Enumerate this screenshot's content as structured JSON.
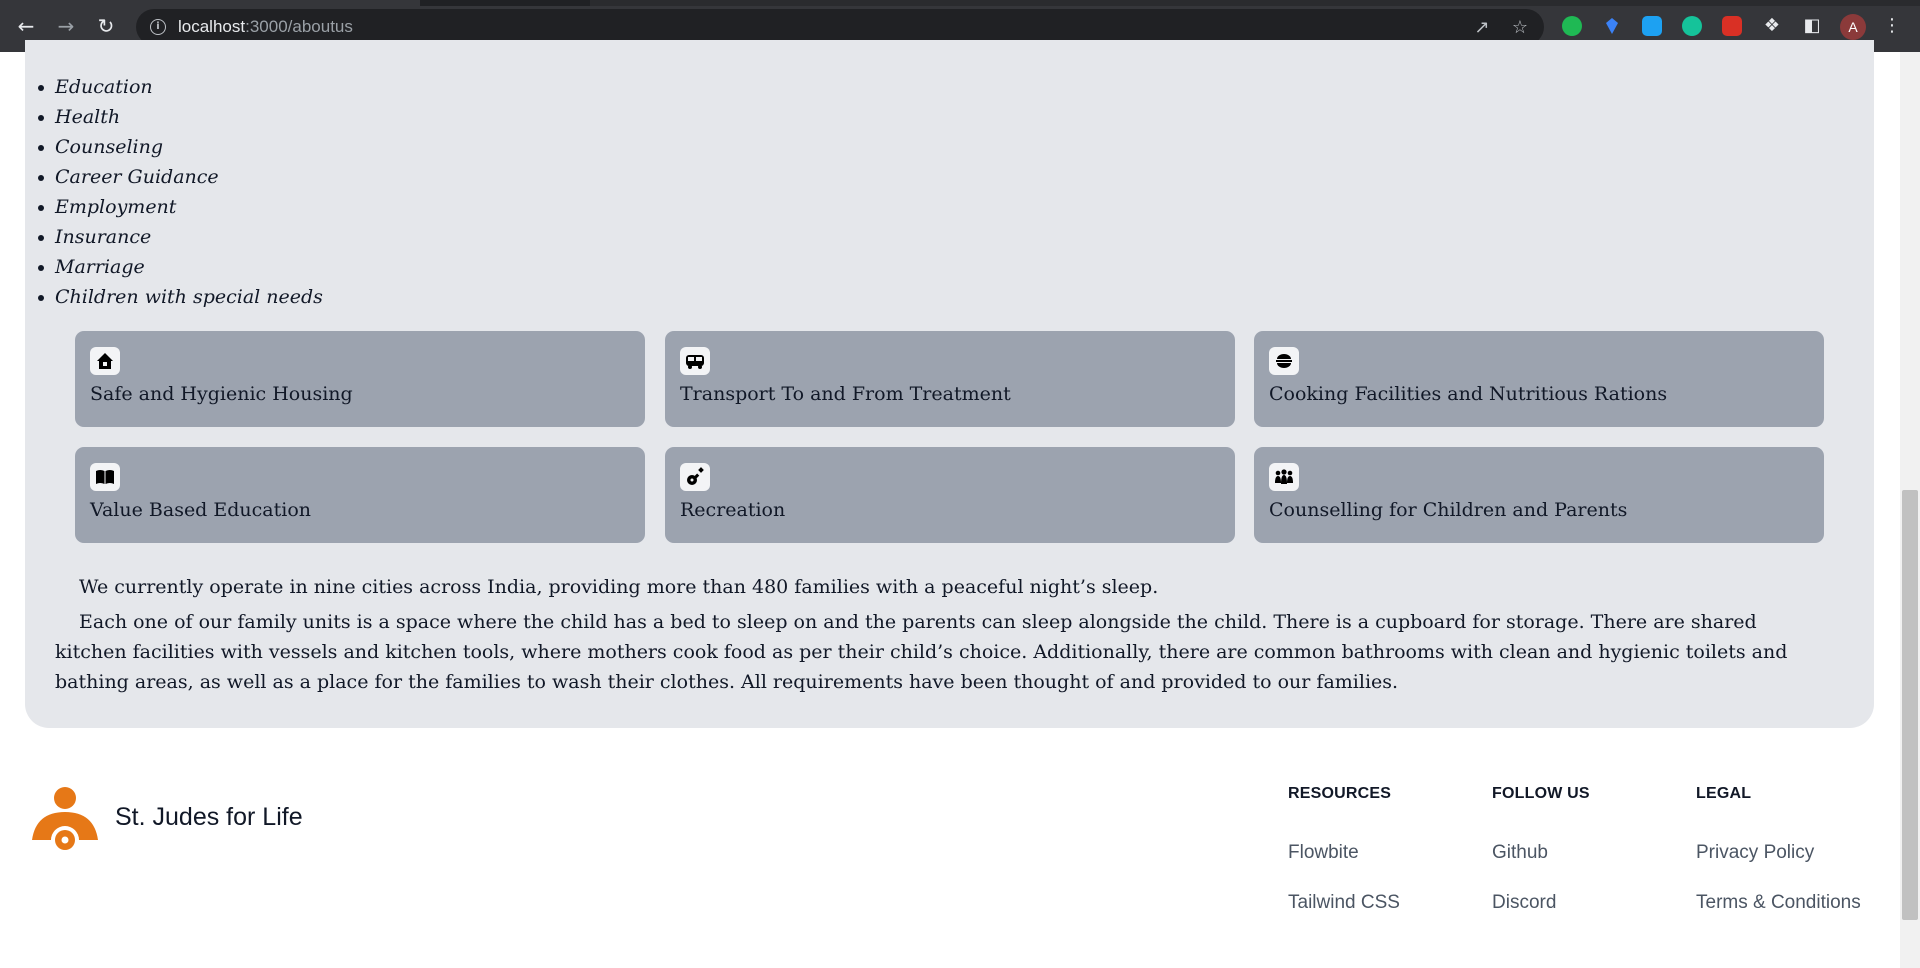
{
  "browser": {
    "url_host": "localhost",
    "url_rest": ":3000/aboutus",
    "avatar_letter": "A"
  },
  "services_list": [
    "Education",
    "Health",
    "Counseling",
    "Career Guidance",
    "Employment",
    "Insurance",
    "Marriage",
    "Children with special needs"
  ],
  "features": [
    {
      "label": "Safe and Hygienic Housing",
      "icon": "house-icon"
    },
    {
      "label": "Transport To and From Treatment",
      "icon": "van-icon"
    },
    {
      "label": "Cooking Facilities and Nutritious Rations",
      "icon": "bowl-icon"
    },
    {
      "label": "Value Based Education",
      "icon": "book-icon"
    },
    {
      "label": "Recreation",
      "icon": "guitar-icon"
    },
    {
      "label": "Counselling for Children and Parents",
      "icon": "people-icon"
    }
  ],
  "paragraphs": {
    "p1": "We currently operate in nine cities across India, providing more than 480 families with a peaceful night’s sleep.",
    "p2": "Each one of our family units is a space where the child has a bed to sleep on and the parents can sleep alongside the child. There is a cupboard for storage. There are shared kitchen facilities with vessels and kitchen tools, where mothers cook food as per their child’s choice. Additionally, there are common bathrooms with clean and hygienic toilets and bathing areas, as well as a place for the families to wash their clothes. All requirements have been thought of and provided to our families."
  },
  "footer": {
    "brand": "St. Judes for Life",
    "brand_color": "#e67817",
    "columns": [
      {
        "heading": "RESOURCES",
        "links": [
          "Flowbite",
          "Tailwind CSS"
        ]
      },
      {
        "heading": "FOLLOW US",
        "links": [
          "Github",
          "Discord"
        ]
      },
      {
        "heading": "LEGAL",
        "links": [
          "Privacy Policy",
          "Terms & Conditions"
        ]
      }
    ]
  },
  "colors": {
    "card_bg": "#e5e7eb",
    "feature_bg": "#9ca3af",
    "chrome_bg": "#35363a"
  }
}
